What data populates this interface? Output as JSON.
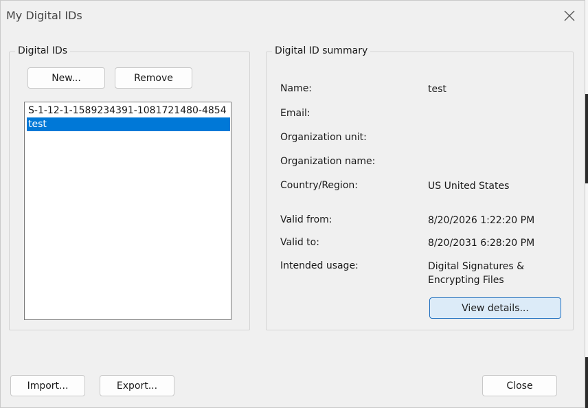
{
  "window": {
    "title": "My Digital IDs"
  },
  "digital_ids": {
    "group_label": "Digital IDs",
    "new_button": "New...",
    "remove_button": "Remove",
    "items": [
      {
        "label": "S-1-12-1-1589234391-1081721480-4854",
        "selected": false
      },
      {
        "label": "test",
        "selected": true
      }
    ]
  },
  "summary": {
    "group_label": "Digital ID summary",
    "fields": [
      {
        "label": "Name:",
        "value": "test"
      },
      {
        "label": "Email:",
        "value": ""
      },
      {
        "label": "Organization unit:",
        "value": ""
      },
      {
        "label": "Organization name:",
        "value": ""
      },
      {
        "label": "Country/Region:",
        "value": "US United States"
      },
      {
        "label": "Valid from:",
        "value": "8/20/2026 1:22:20 PM"
      },
      {
        "label": "Valid to:",
        "value": "8/20/2031 6:28:20 PM"
      },
      {
        "label": "Intended usage:",
        "value": "Digital Signatures & Encrypting Files"
      }
    ],
    "view_details_button": "View details..."
  },
  "footer": {
    "import_button": "Import...",
    "export_button": "Export...",
    "close_button": "Close"
  }
}
